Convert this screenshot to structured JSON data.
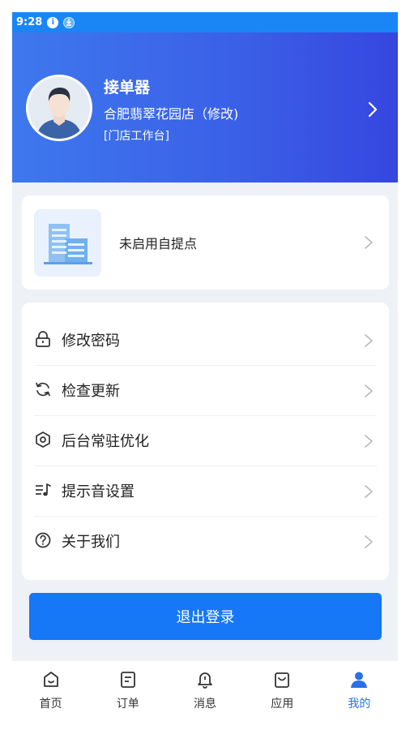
{
  "status_bar": {
    "time": "9:28"
  },
  "profile": {
    "name": "接单器",
    "store": "合肥翡翠花园店（修改)",
    "tag": "[门店工作台]"
  },
  "pickup": {
    "label": "未启用自提点"
  },
  "menu": [
    {
      "label": "修改密码",
      "icon": "lock-icon"
    },
    {
      "label": "检查更新",
      "icon": "refresh-icon"
    },
    {
      "label": "后台常驻优化",
      "icon": "hexagon-settings-icon"
    },
    {
      "label": "提示音设置",
      "icon": "music-note-icon"
    },
    {
      "label": "关于我们",
      "icon": "question-circle-icon"
    }
  ],
  "logout": {
    "label": "退出登录"
  },
  "tabs": [
    {
      "label": "首页",
      "icon": "home-icon"
    },
    {
      "label": "订单",
      "icon": "order-icon"
    },
    {
      "label": "消息",
      "icon": "bell-icon"
    },
    {
      "label": "应用",
      "icon": "bag-icon"
    },
    {
      "label": "我的",
      "icon": "user-icon",
      "active": true
    }
  ],
  "colors": {
    "primary": "#1677f7",
    "header_start": "#3e78ee",
    "header_end": "#3646e0",
    "active_tab": "#2a6fe8",
    "background": "#eef1f6"
  }
}
